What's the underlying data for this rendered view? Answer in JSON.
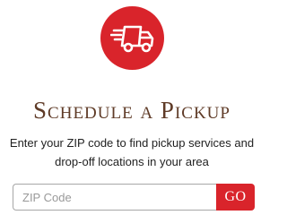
{
  "header": {
    "icon": "delivery-truck-icon",
    "title": "Schedule a Pickup"
  },
  "description": {
    "line1": "Enter your ZIP code to find pickup services and",
    "line2": "drop-off locations in your area"
  },
  "zip_form": {
    "placeholder": "ZIP Code",
    "value": "",
    "button_label": "GO"
  },
  "colors": {
    "accent": "#d9242b",
    "title": "#5f3b27"
  }
}
